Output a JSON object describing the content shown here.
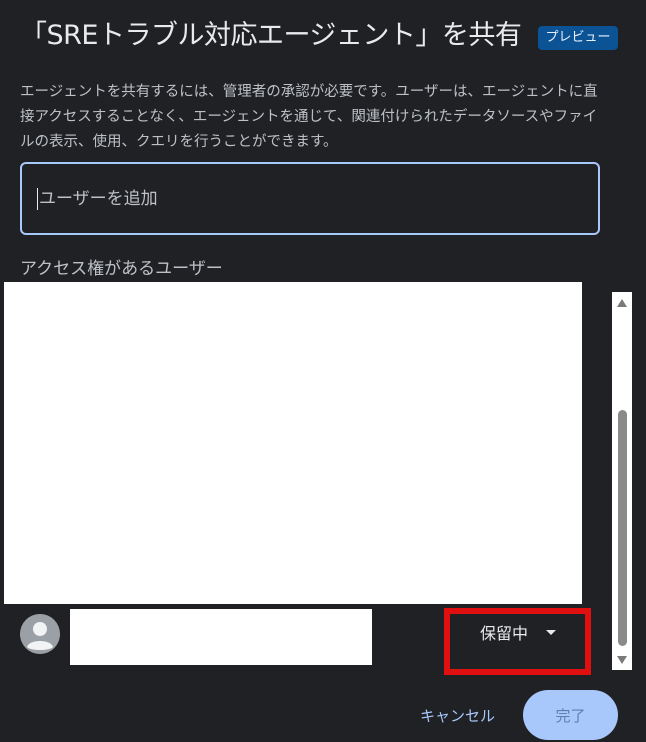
{
  "dialog": {
    "title": "「SREトラブル対応エージェント」を共有",
    "badge": "プレビュー",
    "description": "エージェントを共有するには、管理者の承認が必要です。ユーザーは、エージェントに直接アクセスすることなく、エージェントを通じて、関連付けられたデータソースやファイルの表示、使用、クエリを行うことができます。"
  },
  "add_user": {
    "placeholder": "ユーザーを追加",
    "value": ""
  },
  "access_list": {
    "heading": "アクセス権があるユーザー",
    "users": [
      {
        "avatar_icon": "person-icon",
        "status": "保留中",
        "status_icon": "caret-down-icon"
      }
    ]
  },
  "footer": {
    "cancel_label": "キャンセル",
    "done_label": "完了"
  },
  "colors": {
    "background": "#202124",
    "accent": "#a8c7fa",
    "badge_bg": "#0b5394",
    "highlight": "#e01010"
  }
}
